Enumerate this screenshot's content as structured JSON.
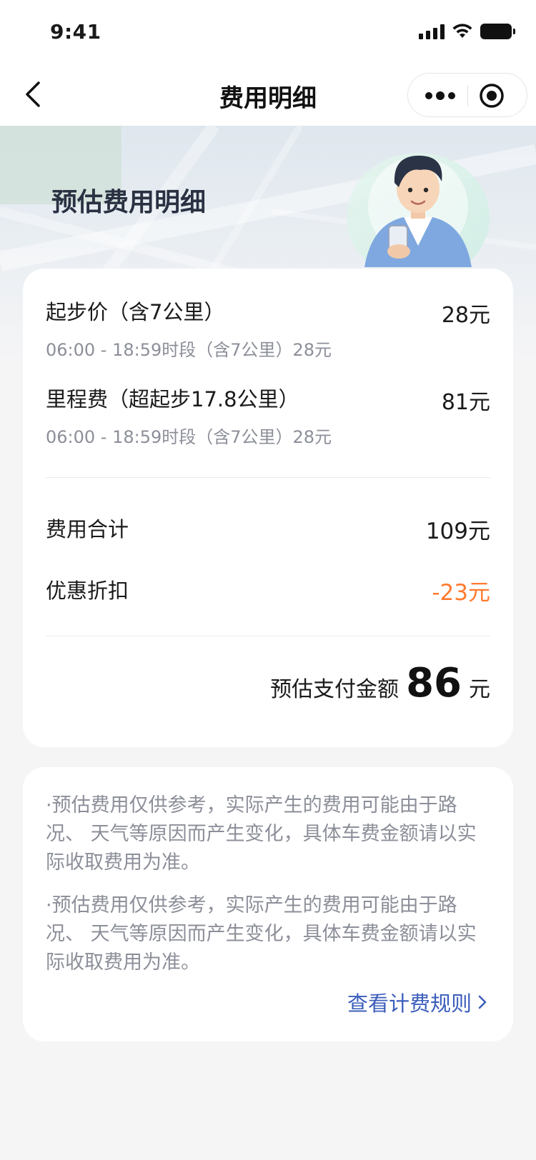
{
  "status_bar": {
    "time": "9:41"
  },
  "nav": {
    "title": "费用明细"
  },
  "banner": {
    "title": "预估费用明细"
  },
  "fees": [
    {
      "label": "起步价（含7公里）",
      "sub": "06:00 - 18:59时段（含7公里）28元",
      "amount": "28元"
    },
    {
      "label": "里程费（超起步17.8公里）",
      "sub": "06:00 - 18:59时段（含7公里）28元",
      "amount": "81元"
    }
  ],
  "summary": {
    "total_label": "费用合计",
    "total_amount": "109元",
    "discount_label": "优惠折扣",
    "discount_amount": "-23元"
  },
  "estimate": {
    "label": "预估支付金额",
    "value": "86",
    "unit": "元"
  },
  "notes": [
    "·预估费用仅供参考，实际产生的费用可能由于路况、 天气等原因而产生变化，具体车费金额请以实际收取费用为准。",
    "·预估费用仅供参考，实际产生的费用可能由于路况、 天气等原因而产生变化，具体车费金额请以实际收取费用为准。"
  ],
  "rules_link": "查看计费规则",
  "colors": {
    "accent_link": "#3b5dbb",
    "discount": "#ff7a2e"
  },
  "icons": [
    "back-icon",
    "more-icon",
    "close-target-icon",
    "chevron-right-icon",
    "signal-icon",
    "wifi-icon",
    "battery-icon"
  ]
}
